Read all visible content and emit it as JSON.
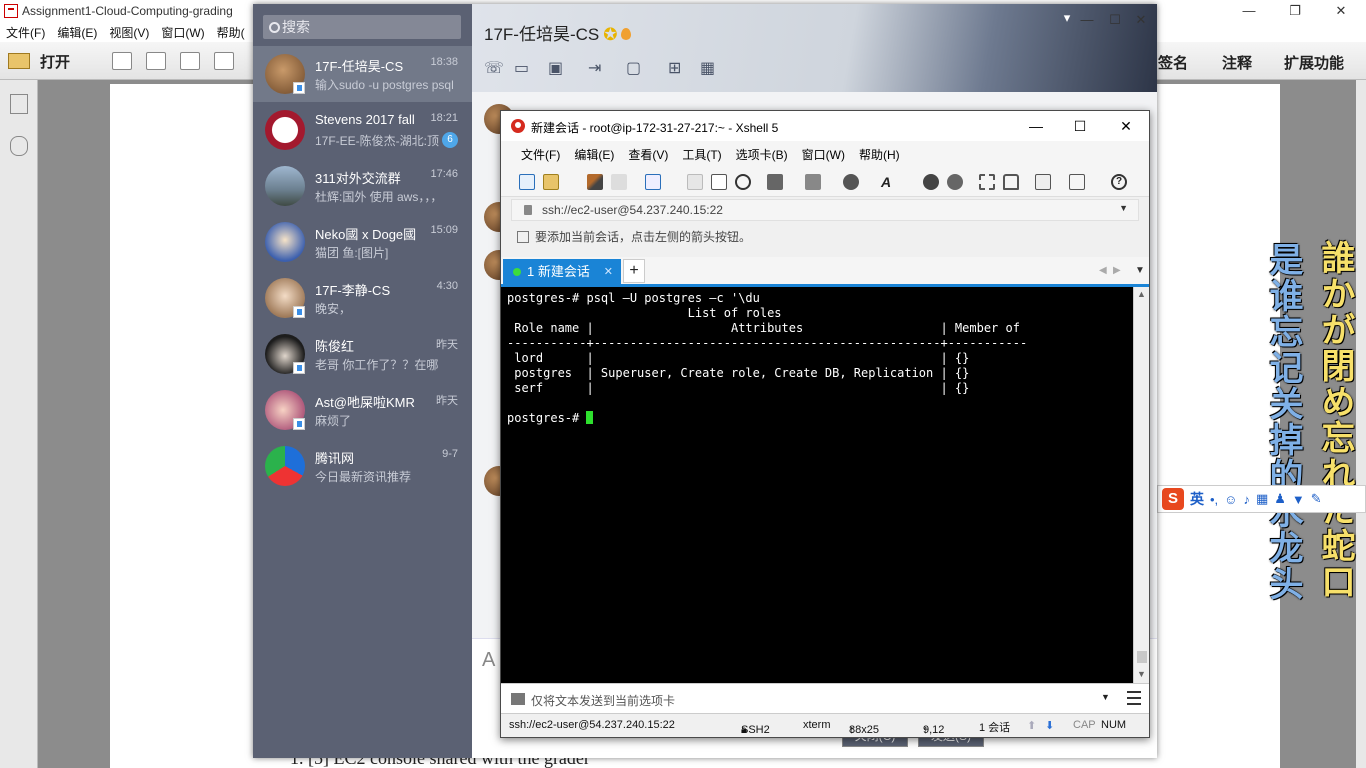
{
  "pdf": {
    "title": "Assignment1-Cloud-Computing-grading",
    "menu": [
      "文件(F)",
      "编辑(E)",
      "视图(V)",
      "窗口(W)",
      "帮助("
    ],
    "open_label": "打开",
    "right_buttons": [
      "签名",
      "注释",
      "扩展功能"
    ],
    "page_text": "1.   [5] EC2 console shared with the grader"
  },
  "lyrics": {
    "japanese": "誰かが閉め忘れた蛇口",
    "chinese": "是谁忘记关掉的水龙头"
  },
  "ime": {
    "language": "英"
  },
  "qq": {
    "search_placeholder": "搜索",
    "chat_title": "17F-任培昊-CS",
    "contacts": [
      {
        "name": "17F-任培昊-CS",
        "message": "输入sudo -u postgres psql 之",
        "time": "18:38"
      },
      {
        "name": "Stevens 2017 fall",
        "message": "17F-EE-陈俊杰-湖北:顶",
        "time": "18:21",
        "badge": "6"
      },
      {
        "name": "311对外交流群",
        "message": "杜辉:国外 使用 aws，，，",
        "time": "17:46"
      },
      {
        "name": "Neko國 x Doge國",
        "message": "猫团 鱼:[图片]",
        "time": "15:09"
      },
      {
        "name": "17F-李静-CS",
        "message": "晚安，",
        "time": "4:30"
      },
      {
        "name": "陈俊红",
        "message": "老哥 你工作了？？在哪",
        "time": "昨天"
      },
      {
        "name": "Ast@吔屎啦KMR",
        "message": "麻烦了",
        "time": "昨天"
      },
      {
        "name": "腾讯网",
        "message": "今日最新资讯推荐",
        "time": "9-7"
      }
    ],
    "input_font_label": "A",
    "close_button": "关闭(C)",
    "send_button": "发送(S)"
  },
  "xshell": {
    "title": "新建会话 - root@ip-172-31-27-217:~ - Xshell 5",
    "menu": [
      "文件(F)",
      "编辑(E)",
      "查看(V)",
      "工具(T)",
      "选项卡(B)",
      "窗口(W)",
      "帮助(H)"
    ],
    "address": "ssh://ec2-user@54.237.240.15:22",
    "hint": "要添加当前会话，点击左侧的箭头按钮。",
    "tab_label": "1 新建会话",
    "terminal_lines": [
      "postgres-# psql —U postgres —c '\\du",
      "                         List of roles",
      " Role name |                   Attributes                   | Member of",
      "-----------+------------------------------------------------+-----------",
      " lord      |                                                | {}",
      " postgres  | Superuser, Create role, Create DB, Replication | {}",
      " serf      |                                                | {}",
      "",
      "postgres-# "
    ],
    "send_hint": "仅将文本发送到当前选项卡",
    "status": {
      "connection": "ssh://ec2-user@54.237.240.15:22",
      "protocol": "SSH2",
      "terminal": "xterm",
      "size": "88x25",
      "cursor_pos": "9,12",
      "sessions": "1 会话",
      "caps": "CAP",
      "num": "NUM"
    }
  }
}
